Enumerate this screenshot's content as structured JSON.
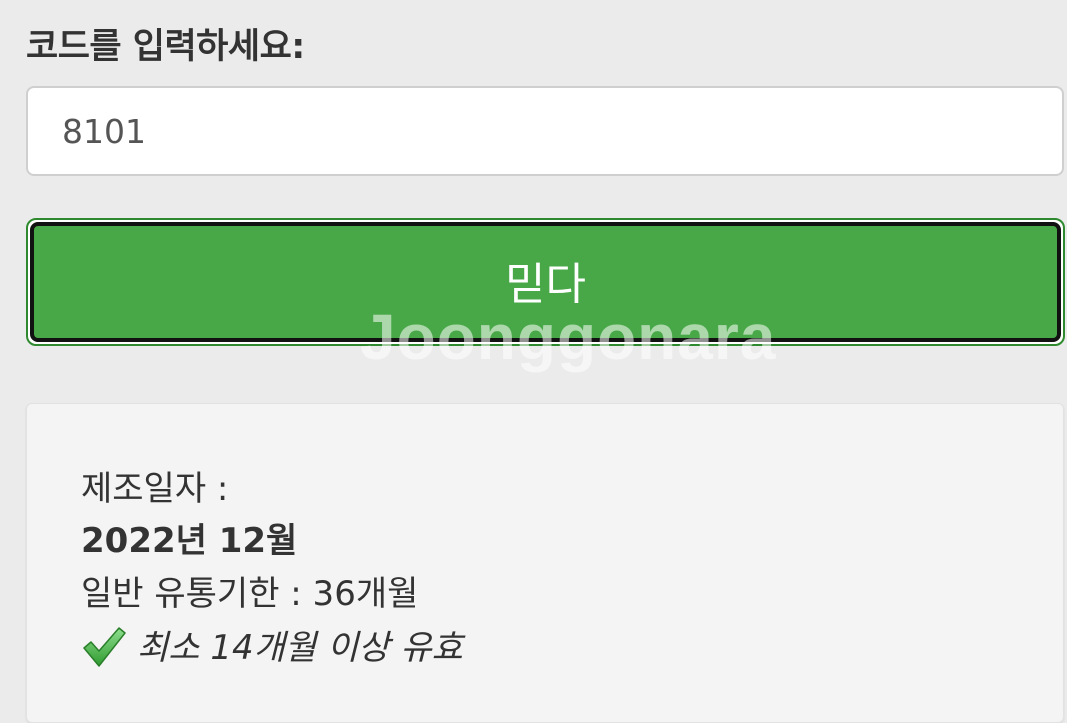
{
  "form": {
    "prompt_label": "코드를 입력하세요:",
    "code_value": "8101",
    "submit_label": "믿다"
  },
  "watermark": "Joonggonara",
  "result": {
    "manufacture_label": "제조일자 :",
    "manufacture_value": "2022년 12월",
    "shelf_life": "일반 유통기한 : 36개월",
    "validity": "최소 14개월 이상 유효"
  },
  "colors": {
    "button_green": "#48a848",
    "check_green": "#4cb84c"
  },
  "icons": {
    "validity_icon": "check-icon"
  }
}
